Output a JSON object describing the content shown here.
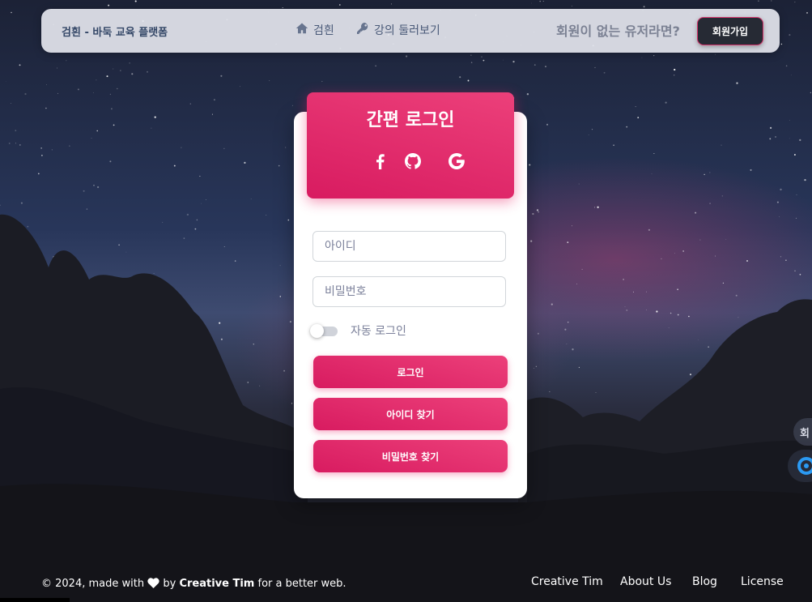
{
  "navbar": {
    "brand": "검흰 - 바둑 교육 플랫폼",
    "links": [
      {
        "label": "검흰",
        "icon": "home-icon"
      },
      {
        "label": "강의 둘러보기",
        "icon": "key-icon"
      }
    ],
    "prompt": "회원이 없는 유저라면?",
    "signup_label": "회원가입"
  },
  "login": {
    "title": "간편 로그인",
    "social_icons": [
      "facebook-icon",
      "github-icon",
      "google-icon"
    ],
    "id_placeholder": "아이디",
    "password_placeholder": "비밀번호",
    "auto_login_label": "자동 로그인",
    "auto_login_on": false,
    "buttons": {
      "login": "로그인",
      "find_id": "아이디 찾기",
      "find_password": "비밀번호 찾기"
    }
  },
  "footer": {
    "copyright": "© 2024, made with",
    "by": "by",
    "author": "Creative Tim",
    "suffix": "for a better web.",
    "links": [
      "Creative Tim",
      "About Us",
      "Blog",
      "License"
    ]
  },
  "side_widget_text": "회",
  "colors": {
    "primary": "#e91e63",
    "navbar_bg": "#e2e4ec",
    "dark_button": "#262a34"
  }
}
